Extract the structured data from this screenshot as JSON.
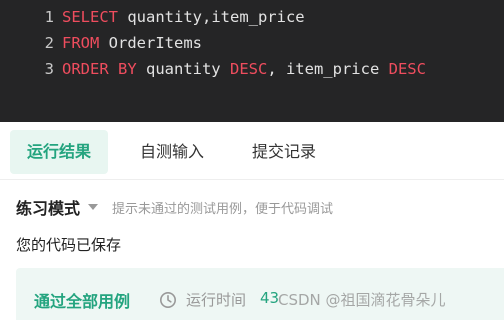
{
  "editor": {
    "lines": [
      {
        "num": "1",
        "parts": [
          {
            "t": "SELECT",
            "k": true
          },
          {
            "t": " quantity,item_price",
            "k": false
          }
        ]
      },
      {
        "num": "2",
        "parts": [
          {
            "t": "FROM",
            "k": true
          },
          {
            "t": " OrderItems",
            "k": false
          }
        ]
      },
      {
        "num": "3",
        "parts": [
          {
            "t": "ORDER BY",
            "k": true
          },
          {
            "t": " quantity ",
            "k": false
          },
          {
            "t": "DESC",
            "k": true
          },
          {
            "t": ", item_price ",
            "k": false
          },
          {
            "t": "DESC",
            "k": true
          }
        ]
      }
    ]
  },
  "tabs": {
    "run_results": "运行结果",
    "self_test": "自测输入",
    "submissions": "提交记录"
  },
  "mode": {
    "label": "练习模式",
    "hint": "提示未通过的测试用例，便于代码调试"
  },
  "status": {
    "saved": "您的代码已保存"
  },
  "result": {
    "pass_label": "通过全部用例",
    "runtime_label": "运行时间",
    "runtime_value": "43",
    "watermark": "CSDN @祖国滴花骨朵儿"
  },
  "colors": {
    "editor_bg": "#252526",
    "keyword": "#ef4d5e",
    "accent_green": "#24a47f"
  }
}
